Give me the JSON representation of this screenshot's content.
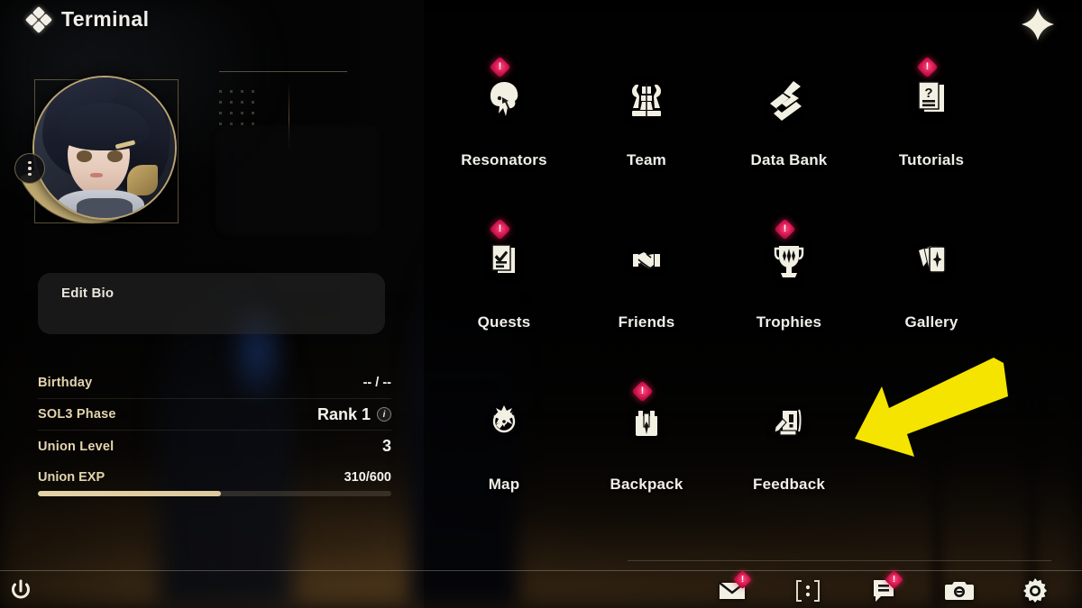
{
  "header": {
    "title": "Terminal",
    "logo_icon": "diamond-cluster-icon",
    "close_icon": "close-star-icon"
  },
  "profile": {
    "avatar_icon": "avatar-portrait",
    "options_icon": "three-dots-icon",
    "edit_bio_label": "Edit Bio",
    "stats": [
      {
        "label": "Birthday",
        "value": "-- / --",
        "has_info": false,
        "big": false
      },
      {
        "label": "SOL3 Phase",
        "value": "Rank 1",
        "has_info": true,
        "info_icon": "info-icon",
        "big": true
      },
      {
        "label": "Union Level",
        "value": "3",
        "has_info": false,
        "big": true
      }
    ],
    "exp": {
      "label": "Union EXP",
      "value": "310/600",
      "current": 310,
      "max": 600,
      "percent": 51.7,
      "fill_color": "#e0cfa4"
    }
  },
  "menu": {
    "rows": [
      [
        {
          "label": "Resonators",
          "icon": "resonator-head-icon",
          "badge": true
        },
        {
          "label": "Team",
          "icon": "chess-pieces-icon",
          "badge": false
        },
        {
          "label": "Data Bank",
          "icon": "data-bank-icon",
          "badge": false
        },
        {
          "label": "Tutorials",
          "icon": "question-document-icon",
          "badge": true
        }
      ],
      [
        {
          "label": "Quests",
          "icon": "checklist-document-icon",
          "badge": true
        },
        {
          "label": "Friends",
          "icon": "handshake-icon",
          "badge": false
        },
        {
          "label": "Trophies",
          "icon": "trophy-icon",
          "badge": true
        },
        {
          "label": "Gallery",
          "icon": "cards-stack-icon",
          "badge": false
        }
      ],
      [
        {
          "label": "Map",
          "icon": "compass-icon",
          "badge": false
        },
        {
          "label": "Backpack",
          "icon": "backpack-icon",
          "badge": true
        },
        {
          "label": "Feedback",
          "icon": "feedback-pen-icon",
          "badge": false
        }
      ]
    ],
    "badge_symbol": "!",
    "badge_color": "#d2154f"
  },
  "annotation": {
    "arrow_icon": "yellow-arrow-icon",
    "arrow_color": "#F4E400",
    "points_to": "Feedback"
  },
  "bottom_bar": {
    "power_icon": "power-icon",
    "items": [
      {
        "icon": "mail-icon",
        "badge": true
      },
      {
        "icon": "more-dots-icon",
        "badge": false
      },
      {
        "icon": "announcement-icon",
        "badge": true
      },
      {
        "icon": "camera-icon",
        "badge": false
      },
      {
        "icon": "gear-icon",
        "badge": false
      }
    ]
  }
}
